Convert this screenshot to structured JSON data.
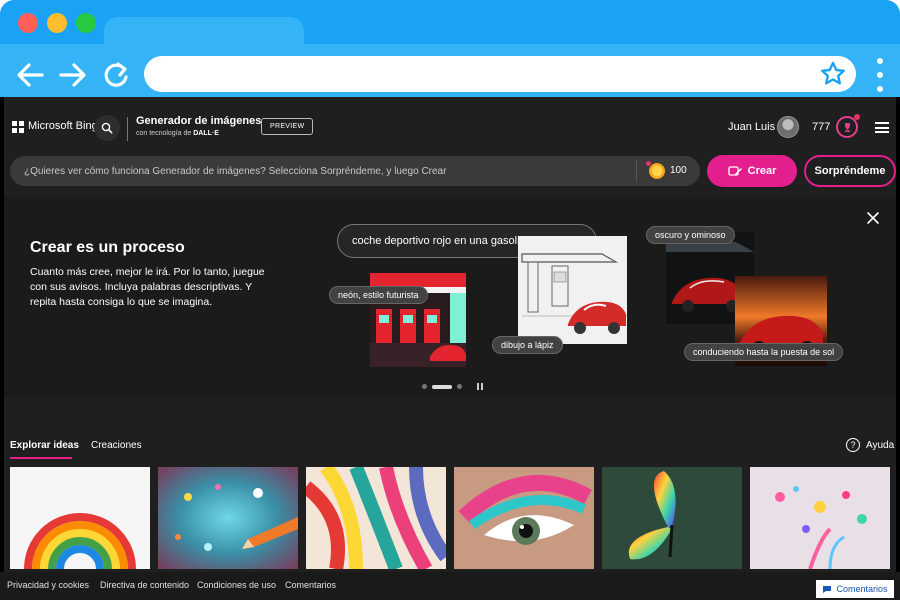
{
  "browser": {
    "traffic_lights": [
      "#ff5f57",
      "#febc2e",
      "#28c840"
    ],
    "chrome_color": "#1aa3f5",
    "url_value": "",
    "icons": [
      "back-arrow-icon",
      "forward-arrow-icon",
      "reload-icon",
      "star-icon",
      "kebab-menu-icon"
    ]
  },
  "header": {
    "brand": "Microsoft Bing",
    "app_title": "Generador de imágenes",
    "app_subtitle_prefix": "con tecnología de",
    "app_subtitle_brand": "DALL·E",
    "badge": "PREVIEW",
    "user_name": "Juan Luis",
    "rewards": "777"
  },
  "prompt": {
    "placeholder": "¿Quieres ver cómo funciona Generador de imágenes? Selecciona Sorpréndeme, y luego Crear",
    "boosts": "100",
    "create_label": "Crear",
    "surprise_label": "Sorpréndeme"
  },
  "hero": {
    "title": "Crear es un proceso",
    "description": "Cuanto más cree, mejor le irá. Por lo tanto, juegue con sus avisos. Incluya palabras descriptivas. Y repita hasta consiga lo que se imagina.",
    "example_prompt": "coche deportivo rojo en una gasolinera",
    "chips": [
      "neón, estilo futurista",
      "dibujo a lápiz",
      "oscuro y ominoso",
      "conduciendo hasta la puesta de sol"
    ],
    "carousel_pages": 3,
    "carousel_active_index": 1
  },
  "explore": {
    "tabs": [
      "Explorar ideas",
      "Creaciones"
    ],
    "active_tab": "Explorar ideas",
    "help_label": "Ayuda"
  },
  "footer": {
    "links": [
      "Privacidad y cookies",
      "Directiva de contenido",
      "Condiciones de uso",
      "Comentarios"
    ],
    "feedback_button": "Comentarios"
  },
  "colors": {
    "accent": "#e31f8e",
    "page_bg": "#1f1f1f"
  }
}
